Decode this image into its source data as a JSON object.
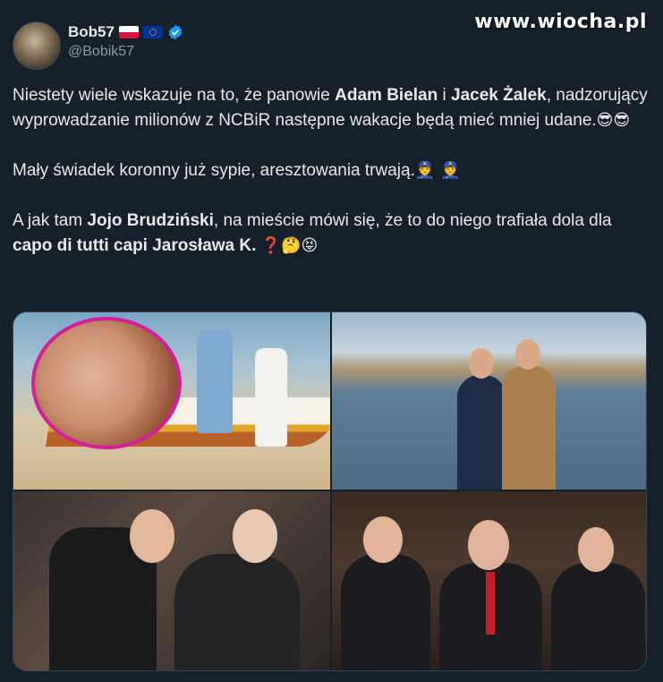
{
  "watermark": "www.wiocha.pl",
  "author": {
    "name": "Bob57",
    "handle": "@Bobik57",
    "flags": [
      "flag-poland-icon",
      "flag-eu-icon"
    ],
    "verified": true
  },
  "tweet": {
    "p1": {
      "t1": "Niestety wiele wskazuje na to, że panowie ",
      "b1": "Adam Bielan",
      "t2": " i ",
      "b2": "Jacek Żalek",
      "t3": ", nadzorujący wyprowadzanie milionów z NCBiR następne wakacje będą mieć mniej udane.",
      "emoji": "😎😎"
    },
    "p2": {
      "t1": "Mały świadek koronny już sypie, aresztowania trwają.",
      "emoji": "👮 👮"
    },
    "p3": {
      "t1": "A jak tam ",
      "b1": "Jojo Brudziński",
      "t2": ", na mieście mówi się, że to do niego trafiała dola dla ",
      "b2": "capo di tutti capi Jarosława K.",
      "emoji_q": "❓",
      "emoji": "🤔😝"
    }
  },
  "media": {
    "photos": [
      {
        "name": "beach-photo"
      },
      {
        "name": "harbor-couple-photo"
      },
      {
        "name": "meeting-photo"
      },
      {
        "name": "audience-photo"
      }
    ]
  },
  "colors": {
    "background": "#15202b",
    "text": "#e7e9ea",
    "secondary_text": "#8b98a5",
    "verified": "#1d9bf0"
  }
}
